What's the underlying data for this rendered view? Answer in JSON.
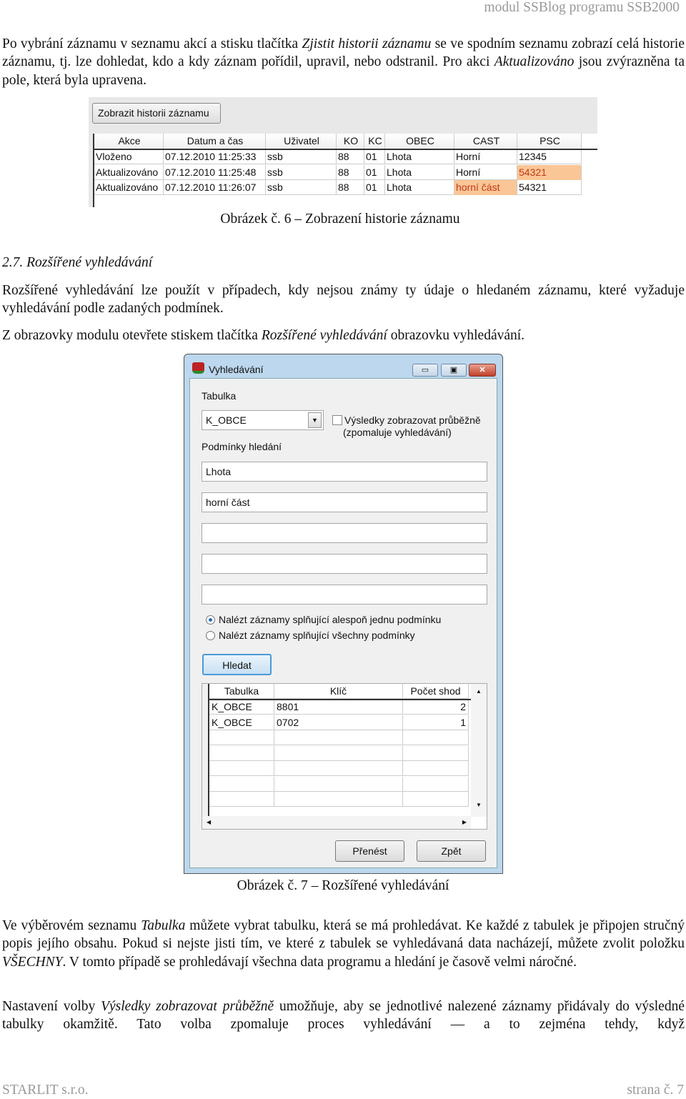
{
  "header": {
    "title": "modul SSBlog programu SSB2000"
  },
  "p1": {
    "a": "Po vybrání záznamu v seznamu akcí a stisku tlačítka ",
    "b": "Zjistit historii záznamu",
    "c": " se ve spodním seznamu zobrazí celá historie záznamu, tj. lze dohledat, kdo a kdy záznam pořídil, upravil, nebo odstranil. Pro akci ",
    "d": "Aktualizováno",
    "e": " jsou zvýrazněna ta pole, která byla upravena."
  },
  "fig6": {
    "button": "Zobrazit historii záznamu",
    "columns": [
      "Akce",
      "Datum a čas",
      "Uživatel",
      "KO",
      "KC",
      "OBEC",
      "CAST",
      "PSC"
    ],
    "rows": [
      [
        "Vloženo",
        "07.12.2010 11:25:33",
        "ssb",
        "88",
        "01",
        "Lhota",
        "Horní",
        "12345"
      ],
      [
        "Aktualizováno",
        "07.12.2010 11:25:48",
        "ssb",
        "88",
        "01",
        "Lhota",
        "Horní",
        "54321"
      ],
      [
        "Aktualizováno",
        "07.12.2010 11:26:07",
        "ssb",
        "88",
        "01",
        "Lhota",
        "horní část",
        "54321"
      ]
    ],
    "highlight_color": "#fbc695",
    "caption": "Obrázek č. 6 – Zobrazení historie záznamu"
  },
  "section": {
    "heading": "2.7. Rozšířené vyhledávání"
  },
  "p2": "Rozšířené vyhledávání lze použít v případech, kdy nejsou známy ty údaje o hledaném záznamu, které vyžaduje vyhledávání podle zadaných podmínek.",
  "p3": {
    "a": "Z obrazovky modulu otevřete stiskem tlačítka ",
    "b": "Rozšířené vyhledávání",
    "c": " obrazovku vyhledávání."
  },
  "dialog": {
    "title": "Vyhledávání",
    "table_label": "Tabulka",
    "table_value": "K_OBCE",
    "checkbox_label1": "Výsledky zobrazovat průběžně",
    "checkbox_label2": "(zpomaluje vyhledávání)",
    "checkbox_checked": false,
    "conditions_label": "Podmínky hledání",
    "conditions": [
      "Lhota",
      "horní část",
      "",
      "",
      ""
    ],
    "radio1": "Nalézt záznamy splňující alespoň jednu podmínku",
    "radio2": "Nalézt záznamy splňující všechny podmínky",
    "radio_selected": 1,
    "search_button": "Hledat",
    "columns": [
      "Tabulka",
      "Klíč",
      "Počet shod"
    ],
    "rows": [
      [
        "K_OBCE",
        "8801",
        "2"
      ],
      [
        "K_OBCE",
        "0702",
        "1"
      ]
    ],
    "transfer_button": "Přenést",
    "back_button": "Zpět"
  },
  "fig7": {
    "caption": "Obrázek č. 7 – Rozšířené vyhledávání"
  },
  "p4": {
    "a": "Ve výběrovém seznamu ",
    "b": "Tabulka",
    "c": " můžete vybrat tabulku, která se má prohledávat. Ke každé z tabulek je připojen stručný popis jejího obsahu. Pokud si nejste jisti tím, ve které z tabulek se vyhledávaná data nacházejí, můžete zvolit položku ",
    "d": "VŠECHNY",
    "e": ". V tomto případě se prohledávají všechna data programu a hledání je časově velmi náročné."
  },
  "p5": {
    "a": "Nastavení volby ",
    "b": "Výsledky zobrazovat průběžně",
    "c": " umožňuje, aby se jednotlivé nalezené záznamy přidávaly do výsledné tabulky okamžitě. Tato volba zpomaluje proces vyhledávání — a to zejména tehdy, když"
  },
  "footer": {
    "left": "STARLIT s.r.o.",
    "right": "strana č. 7"
  }
}
